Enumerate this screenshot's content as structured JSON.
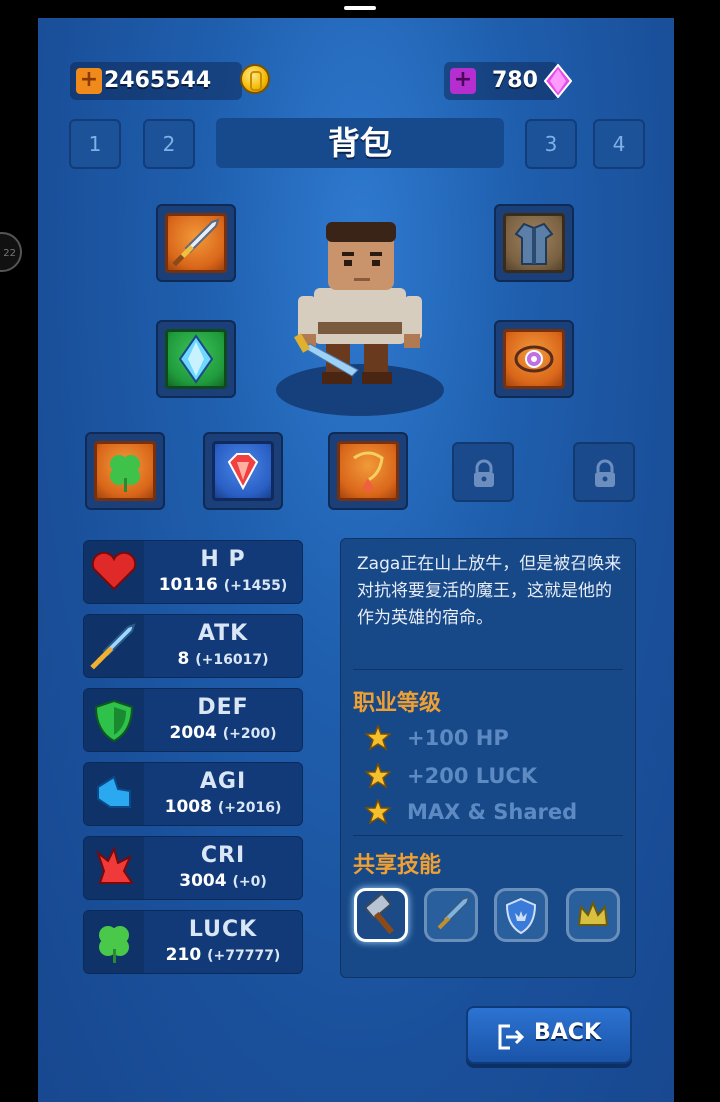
{
  "currencies": {
    "gold": {
      "value": "2465544",
      "color": "#f5b800"
    },
    "gems": {
      "value": "780",
      "color": "#d33cd8"
    }
  },
  "tabs": [
    "1",
    "2",
    "3",
    "4"
  ],
  "title": "背包",
  "equipment": {
    "top_left": "sword-icon",
    "top_right": "armor-icon",
    "mid_left": "crystal-icon",
    "mid_right": "amulet-icon",
    "bottom": [
      "clover-icon",
      "ruby-icon",
      "necklace-icon",
      "lock-icon",
      "lock-icon"
    ]
  },
  "stats": [
    {
      "name": "H P",
      "value": "10116",
      "bonus": "(+1455)",
      "icon": "heart-icon"
    },
    {
      "name": "ATK",
      "value": "8",
      "bonus": "(+16017)",
      "icon": "sword-icon"
    },
    {
      "name": "DEF",
      "value": "2004",
      "bonus": "(+200)",
      "icon": "shield-icon"
    },
    {
      "name": "AGI",
      "value": "1008",
      "bonus": "(+2016)",
      "icon": "boot-icon"
    },
    {
      "name": "CRI",
      "value": "3004",
      "bonus": "(+0)",
      "icon": "burst-icon"
    },
    {
      "name": "LUCK",
      "value": "210",
      "bonus": "(+77777)",
      "icon": "clover-icon"
    }
  ],
  "description": "Zaga正在山上放牛，但是被召唤来对抗将要复活的魔王，这就是他的作为英雄的宿命。",
  "class_level": {
    "title": "职业等级",
    "perks": [
      "+100 HP",
      "+200 LUCK",
      "MAX & Shared"
    ]
  },
  "shared_skills": {
    "title": "共享技能",
    "skills": [
      "hammer-icon",
      "sword-icon",
      "shield-crest-icon",
      "crown-icon"
    ]
  },
  "back_button": "BACK"
}
